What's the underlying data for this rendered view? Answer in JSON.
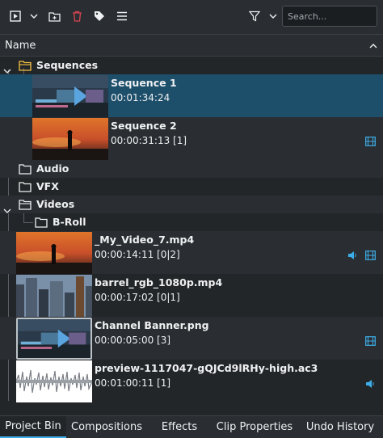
{
  "toolbar": {
    "search_placeholder": "Search...",
    "icons": [
      "play-menu-icon",
      "chevron-down-icon",
      "add-folder-icon",
      "trash-icon",
      "tag-icon",
      "hamburger-menu-icon",
      "filter-icon",
      "chevron-down-icon"
    ]
  },
  "header": {
    "name_label": "Name"
  },
  "tree": {
    "sequences": {
      "label": "Sequences"
    },
    "seq1": {
      "name": "Sequence 1",
      "meta": "00:01:34:24"
    },
    "seq2": {
      "name": "Sequence 2",
      "meta": "00:00:31:13 [1]"
    },
    "audio": {
      "label": "Audio"
    },
    "vfx": {
      "label": "VFX"
    },
    "videos": {
      "label": "Videos"
    },
    "broll": {
      "label": "B-Roll"
    },
    "clip1": {
      "name": "_My_Video_7.mp4",
      "meta": "00:00:14:11 [0|2]"
    },
    "clip2": {
      "name": "barrel_rgb_1080p.mp4",
      "meta": "00:00:17:02 [0|1]"
    },
    "clip3": {
      "name": "Channel Banner.png",
      "meta": "00:00:05:00 [3]"
    },
    "clip4": {
      "name": "preview-1117047-gQJCd9lRHy-high.ac3",
      "meta": "00:01:00:11 [1]"
    }
  },
  "tabs": [
    "Project Bin",
    "Compositions",
    "Effects",
    "Clip Properties",
    "Undo History"
  ],
  "colors": {
    "accent": "#3daee9",
    "selection": "#1d4f6b",
    "folder_yellow": "#f5c242",
    "trash_red": "#da4453"
  }
}
